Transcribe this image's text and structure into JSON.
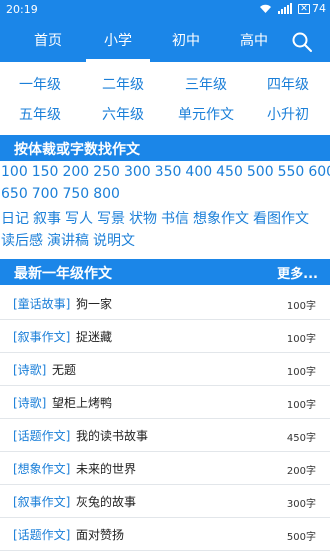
{
  "status": {
    "time": "20:19",
    "battery": "74"
  },
  "nav": {
    "tabs": [
      "首页",
      "小学",
      "初中",
      "高中"
    ],
    "active_tab": "小学"
  },
  "grades": [
    "一年级",
    "二年级",
    "三年级",
    "四年级",
    "五年级",
    "六年级",
    "单元作文",
    "小升初"
  ],
  "filter": {
    "title": "按体裁或字数找作文",
    "word_counts_line1": [
      "100",
      "150",
      "200",
      "250",
      "300",
      "350",
      "400",
      "450",
      "500",
      "550",
      "600"
    ],
    "word_counts_line2": [
      "650",
      "700",
      "750",
      "800"
    ],
    "genres_line1": [
      "日记",
      "叙事",
      "写人",
      "写景",
      "状物",
      "书信",
      "想象作文",
      "看图作文"
    ],
    "genres_line2": [
      "读后感",
      "演讲稿",
      "说明文"
    ]
  },
  "latest": {
    "title": "最新一年级作文",
    "more_label": "更多...",
    "items": [
      {
        "category": "[童话故事]",
        "title": "狗一家",
        "count": "100字"
      },
      {
        "category": "[叙事作文]",
        "title": "捉迷藏",
        "count": "100字"
      },
      {
        "category": "[诗歌]",
        "title": "无题",
        "count": "100字"
      },
      {
        "category": "[诗歌]",
        "title": "望柜上烤鸭",
        "count": "100字"
      },
      {
        "category": "[话题作文]",
        "title": "我的读书故事",
        "count": "450字"
      },
      {
        "category": "[想象作文]",
        "title": "未来的世界",
        "count": "200字"
      },
      {
        "category": "[叙事作文]",
        "title": "灰兔的故事",
        "count": "300字"
      },
      {
        "category": "[话题作文]",
        "title": "面对赞扬",
        "count": "500字"
      }
    ]
  },
  "icons": {
    "wifi": "wifi-icon",
    "signal": "signal-icon",
    "notification": "notification-icon",
    "search": "search-icon"
  },
  "colors": {
    "primary": "#1b86e8",
    "link": "#1b7fd8"
  }
}
